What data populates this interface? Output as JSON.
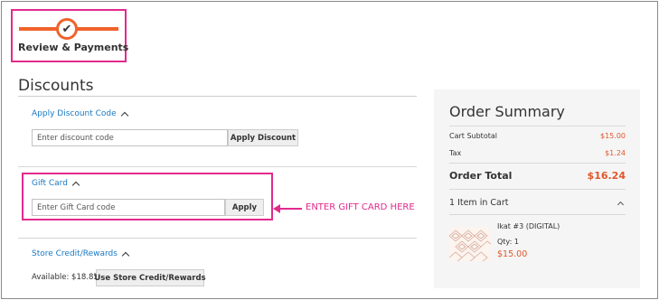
{
  "progress": {
    "step_label": "Review & Payments",
    "check_glyph": "✔"
  },
  "discounts": {
    "title": "Discounts",
    "discount_code": {
      "toggle_label": "Apply Discount Code",
      "placeholder": "Enter discount code",
      "button_label": "Apply Discount"
    },
    "gift_card": {
      "toggle_label": "Gift Card",
      "placeholder": "Enter Gift Card code",
      "button_label": "Apply",
      "annotation": "ENTER GIFT CARD HERE"
    },
    "store_credit": {
      "toggle_label": "Store Credit/Rewards",
      "available_text": "Available: $18.85",
      "button_label": "Use Store Credit/Rewards"
    }
  },
  "order_summary": {
    "title": "Order Summary",
    "subtotal_label": "Cart Subtotal",
    "subtotal_value": "$15.00",
    "tax_label": "Tax",
    "tax_value": "$1.24",
    "total_label": "Order Total",
    "total_value": "$16.24",
    "items_label": "1 Item in Cart",
    "item": {
      "name": "Ikat #3 (DIGITAL)",
      "qty_text": "Qty: 1",
      "price": "$15.00"
    }
  },
  "colors": {
    "highlight": "#e22a8c",
    "progress": "#f0622a",
    "link": "#1979c3",
    "price": "#e0572b"
  }
}
